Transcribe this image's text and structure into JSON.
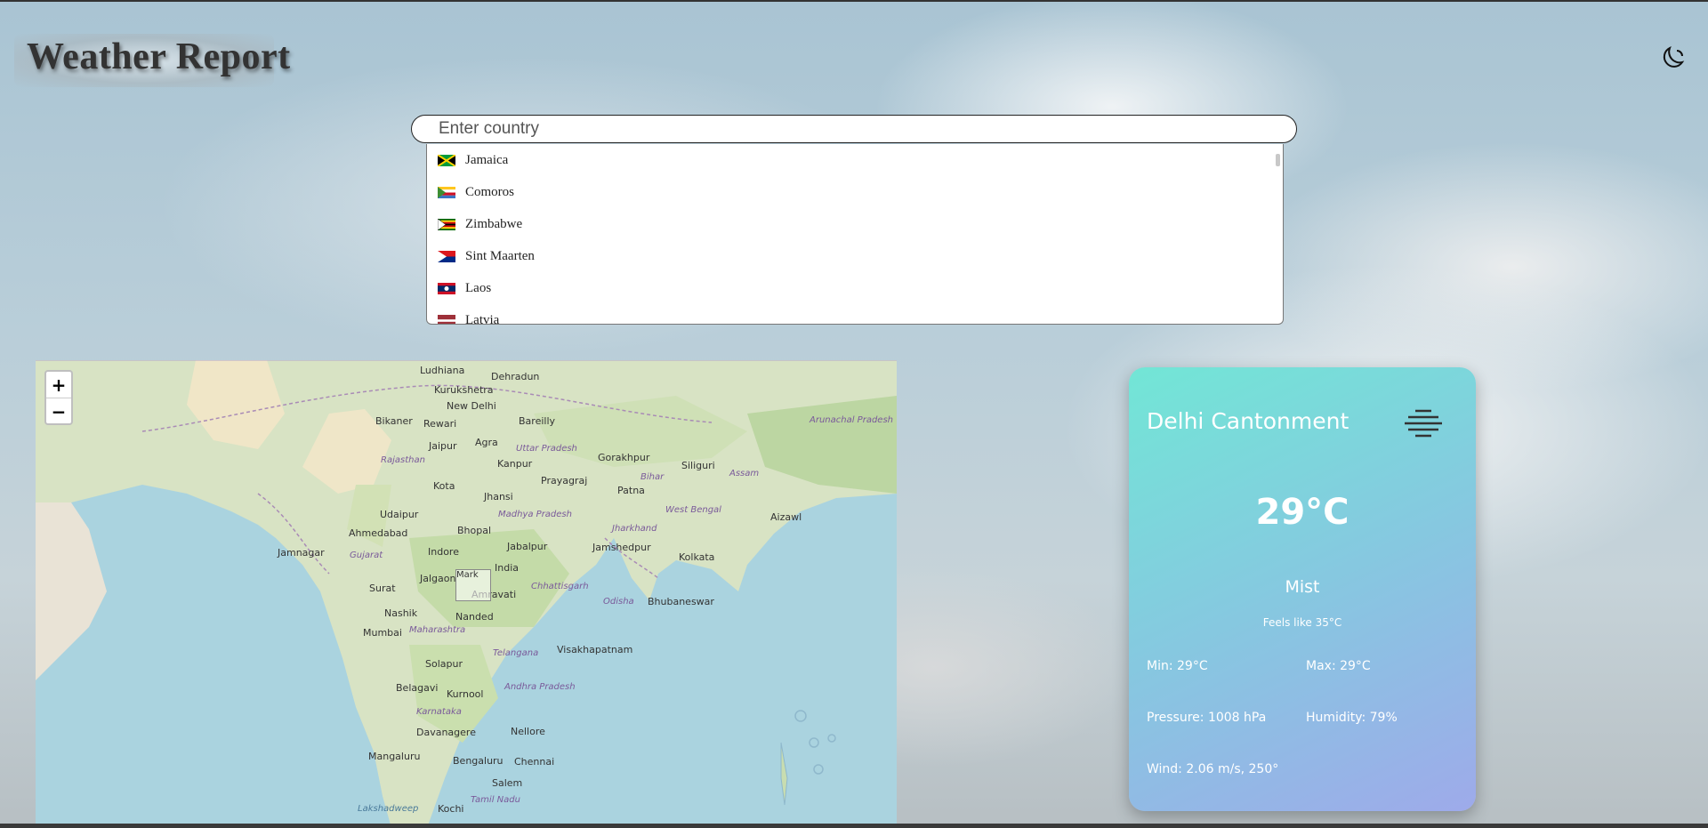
{
  "brand": {
    "title": "Weather Report"
  },
  "theme_toggle": {
    "icon": "moon-icon"
  },
  "search": {
    "placeholder": "Enter country",
    "value": ""
  },
  "country_dropdown": {
    "items": [
      {
        "name": "Jamaica",
        "flag": "jamaica-flag-icon"
      },
      {
        "name": "Comoros",
        "flag": "comoros-flag-icon"
      },
      {
        "name": "Zimbabwe",
        "flag": "zimbabwe-flag-icon"
      },
      {
        "name": "Sint Maarten",
        "flag": "sint-maarten-flag-icon"
      },
      {
        "name": "Laos",
        "flag": "laos-flag-icon"
      },
      {
        "name": "Latvia",
        "flag": "latvia-flag-icon"
      }
    ]
  },
  "map": {
    "zoom_in": "+",
    "zoom_out": "−",
    "marker_alt": "Mark",
    "labels": [
      "Ludhiana",
      "Dehradun",
      "Kurukshetra",
      "New Delhi",
      "Bikaner",
      "Rewari",
      "Bareilly",
      "Jaipur",
      "Agra",
      "Uttar Pradesh",
      "Rajasthan",
      "Kanpur",
      "Gorakhpur",
      "Siliguri",
      "Prayagraj",
      "Bihar",
      "Assam",
      "Kota",
      "Jhansi",
      "Patna",
      "Udaipur",
      "Madhya Pradesh",
      "West Bengal",
      "Aizawl",
      "Ahmedabad",
      "Bhopal",
      "Jharkhand",
      "Gujarat",
      "Indore",
      "Jabalpur",
      "Jamshedpur",
      "Kolkata",
      "Jamnagar",
      "India",
      "Jalgaon",
      "Amravati",
      "Chhattisgarh",
      "Odisha",
      "Bhubaneswar",
      "Surat",
      "Nashik",
      "Nanded",
      "Mumbai",
      "Maharashtra",
      "Telangana",
      "Visakhapatnam",
      "Solapur",
      "Kurnool",
      "Belagavi",
      "Andhra Pradesh",
      "Karnataka",
      "Davanagere",
      "Nellore",
      "Chennai",
      "Mangaluru",
      "Bengaluru",
      "Salem",
      "Tamil Nadu",
      "Kochi",
      "Lakshadweep",
      "Arunachal Pradesh"
    ]
  },
  "weather": {
    "city": "Delhi Cantonment",
    "condition_icon": "mist-icon",
    "temperature": "29°C",
    "condition": "Mist",
    "feels_like": "Feels like 35°C",
    "min": "Min: 29°C",
    "max": "Max: 29°C",
    "pressure": "Pressure: 1008 hPa",
    "humidity": "Humidity: 79%",
    "wind": "Wind: 2.06 m/s, 250°"
  }
}
